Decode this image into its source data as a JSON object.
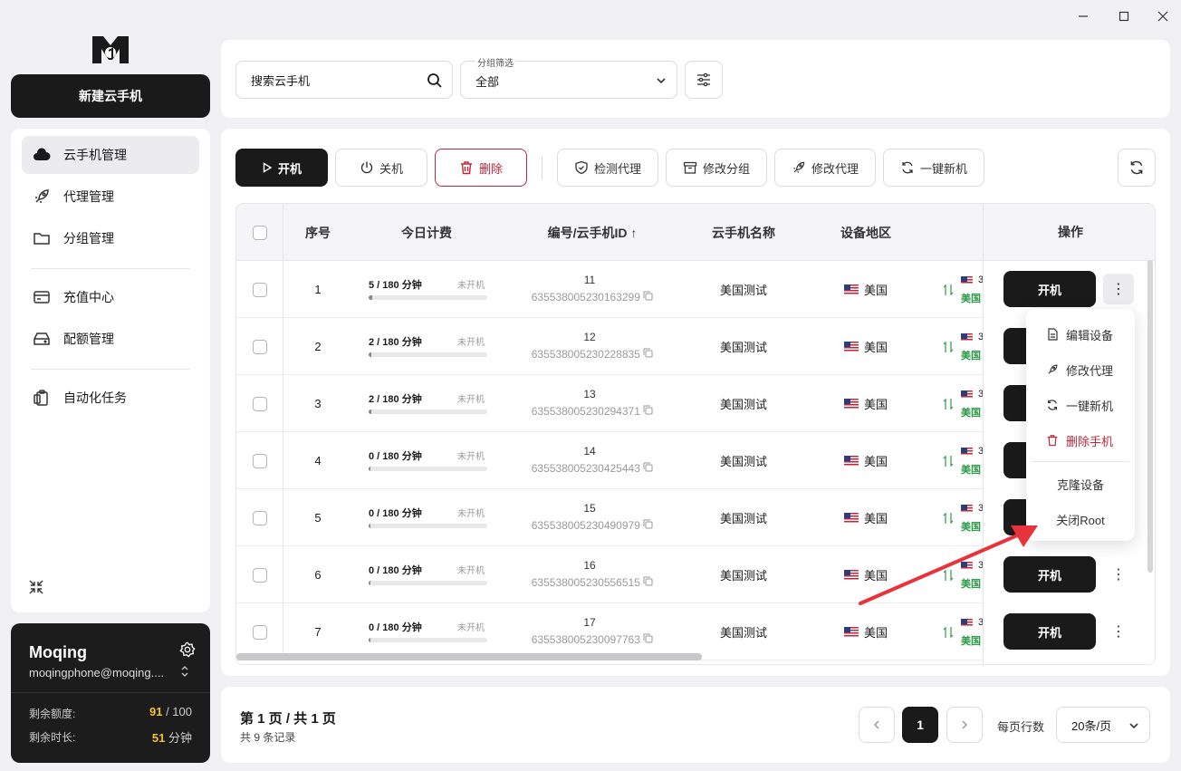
{
  "sidebar": {
    "new_button": "新建云手机",
    "items": [
      {
        "label": "云手机管理",
        "icon": "cloud-icon",
        "active": true
      },
      {
        "label": "代理管理",
        "icon": "rocket-icon"
      },
      {
        "label": "分组管理",
        "icon": "folder-icon"
      },
      {
        "label": "充值中心",
        "icon": "card-icon"
      },
      {
        "label": "配额管理",
        "icon": "storage-icon"
      },
      {
        "label": "自动化任务",
        "icon": "clipboard-icon"
      }
    ],
    "user": {
      "name": "Moqing",
      "email": "moqingphone@moqing....",
      "quota_label": "剩余额度:",
      "quota_used": "91",
      "quota_total": "/ 100",
      "time_label": "剩余时长:",
      "time_value": "51",
      "time_unit": "分钟"
    }
  },
  "search": {
    "placeholder": "搜索云手机"
  },
  "group_filter": {
    "label": "分组筛选",
    "value": "全部"
  },
  "toolbar": {
    "start": "开机",
    "stop": "关机",
    "delete": "删除",
    "check_proxy": "检测代理",
    "change_group": "修改分组",
    "change_proxy": "修改代理",
    "new_device": "一键新机"
  },
  "table": {
    "headers": {
      "index": "序号",
      "billing": "今日计费",
      "id": "编号/云手机ID ↑",
      "name": "云手机名称",
      "region": "设备地区",
      "actions": "操作"
    },
    "rows": [
      {
        "index": "1",
        "billing": "5 / 180 分钟",
        "fill": 0.028,
        "status": "未开机",
        "num": "11",
        "long_id": "635538005230163299",
        "name": "美国测试",
        "region": "美国"
      },
      {
        "index": "2",
        "billing": "2 / 180 分钟",
        "fill": 0.011,
        "status": "未开机",
        "num": "12",
        "long_id": "635538005230228835",
        "name": "美国测试",
        "region": "美国"
      },
      {
        "index": "3",
        "billing": "2 / 180 分钟",
        "fill": 0.011,
        "status": "未开机",
        "num": "13",
        "long_id": "635538005230294371",
        "name": "美国测试",
        "region": "美国"
      },
      {
        "index": "4",
        "billing": "0 / 180 分钟",
        "fill": 0,
        "status": "未开机",
        "num": "14",
        "long_id": "635538005230425443",
        "name": "美国测试",
        "region": "美国"
      },
      {
        "index": "5",
        "billing": "0 / 180 分钟",
        "fill": 0,
        "status": "未开机",
        "num": "15",
        "long_id": "635538005230490979",
        "name": "美国测试",
        "region": "美国"
      },
      {
        "index": "6",
        "billing": "0 / 180 分钟",
        "fill": 0,
        "status": "未开机",
        "num": "16",
        "long_id": "635538005230556515",
        "name": "美国测试",
        "region": "美国"
      },
      {
        "index": "7",
        "billing": "0 / 180 分钟",
        "fill": 0,
        "status": "未开机",
        "num": "17",
        "long_id": "635538005230097763",
        "name": "美国测试",
        "region": "美国"
      }
    ],
    "proxy_partial": "3",
    "proxy_region": "美国",
    "row_action": "开机"
  },
  "menu": {
    "edit_device": "编辑设备",
    "change_proxy": "修改代理",
    "new_device": "一键新机",
    "delete_phone": "删除手机",
    "clone_device": "克隆设备",
    "close_root": "关闭Root"
  },
  "pagination": {
    "page_info": "第 1 页 / 共 1 页",
    "total": "共 9 条记录",
    "current": "1",
    "rows_label": "每页行数",
    "rows_value": "20条/页"
  },
  "colors": {
    "accent": "#1a1a1a",
    "danger": "#c0263b",
    "quota": "#f2c230",
    "arrow": "#e8323c",
    "green": "#2e9a4a"
  }
}
